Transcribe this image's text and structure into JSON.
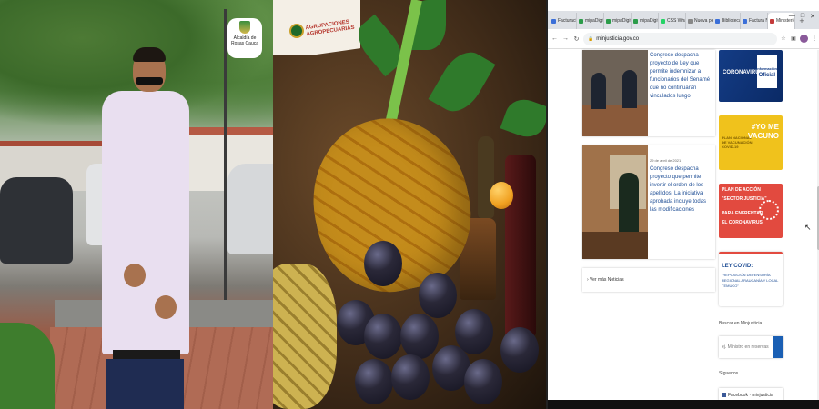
{
  "panel1": {
    "logo": {
      "text": "Alcaldía de Rosas Cauca"
    }
  },
  "panel2": {
    "label": {
      "text": "AGRUPACIONES AGROPECUARIAS"
    }
  },
  "browser": {
    "tabs": [
      {
        "label": "Facturación",
        "color": "#3b6fd8"
      },
      {
        "label": "mipaDigital",
        "color": "#2c9c4a"
      },
      {
        "label": "mipaDigital",
        "color": "#2c9c4a"
      },
      {
        "label": "mipaDigital",
        "color": "#2c9c4a"
      },
      {
        "label": "CSS Whatsa",
        "color": "#25d366"
      },
      {
        "label": "Nueva pestaña",
        "color": "#888888"
      },
      {
        "label": "Biblioteca",
        "color": "#3b6fd8"
      },
      {
        "label": "Factura Nro",
        "color": "#3b6fd8"
      },
      {
        "label": "Ministerio",
        "color": "#c43a3a",
        "active": true
      }
    ],
    "new_tab": "+",
    "address": "minjusticia.gov.co",
    "win_controls": [
      "—",
      "□",
      "✕"
    ]
  },
  "page": {
    "news": [
      {
        "date": "",
        "title": "Congreso despacha proyecto de Ley que permite indemnizar a funcionarios del Senamé que no continuarán vinculados luego"
      },
      {
        "date": "29 de abril de 2021",
        "title": "Congreso despacha proyecto que permite invertir el orden de los apellidos. La iniciativa aprobada incluye todas las modificaciones"
      }
    ],
    "more_news": "› Ver más Noticias",
    "banners": {
      "b1_line1": "Información",
      "b1_line2": "Oficial",
      "b1_sub": "CORONAVIRUS",
      "b2_line1": "#YO ME",
      "b2_line2": "VACUNO",
      "b2_sub": "PLAN NACIONAL DE VACUNACIÓN COVID-19",
      "b3_line1": "PLAN DE ACCIÓN",
      "b3_line2": "\"SECTOR JUSTICIA\"",
      "b3_line3": "PARA ENFRENTAR",
      "b3_line4": "EL CORONAVIRUS",
      "b4_title": "LEY COVID:",
      "b4_text": "\"REPOSICIÓN DEFENSORÍA REGIONAL ARAUCANÍA Y LOCAL TEMUCO\""
    },
    "search_label": "Buscar en Minjusticia",
    "search_placeholder": "ej. Ministro en reservas",
    "follow_label": "Síguenos",
    "facebook_label": "Facebook · minjusticia"
  }
}
